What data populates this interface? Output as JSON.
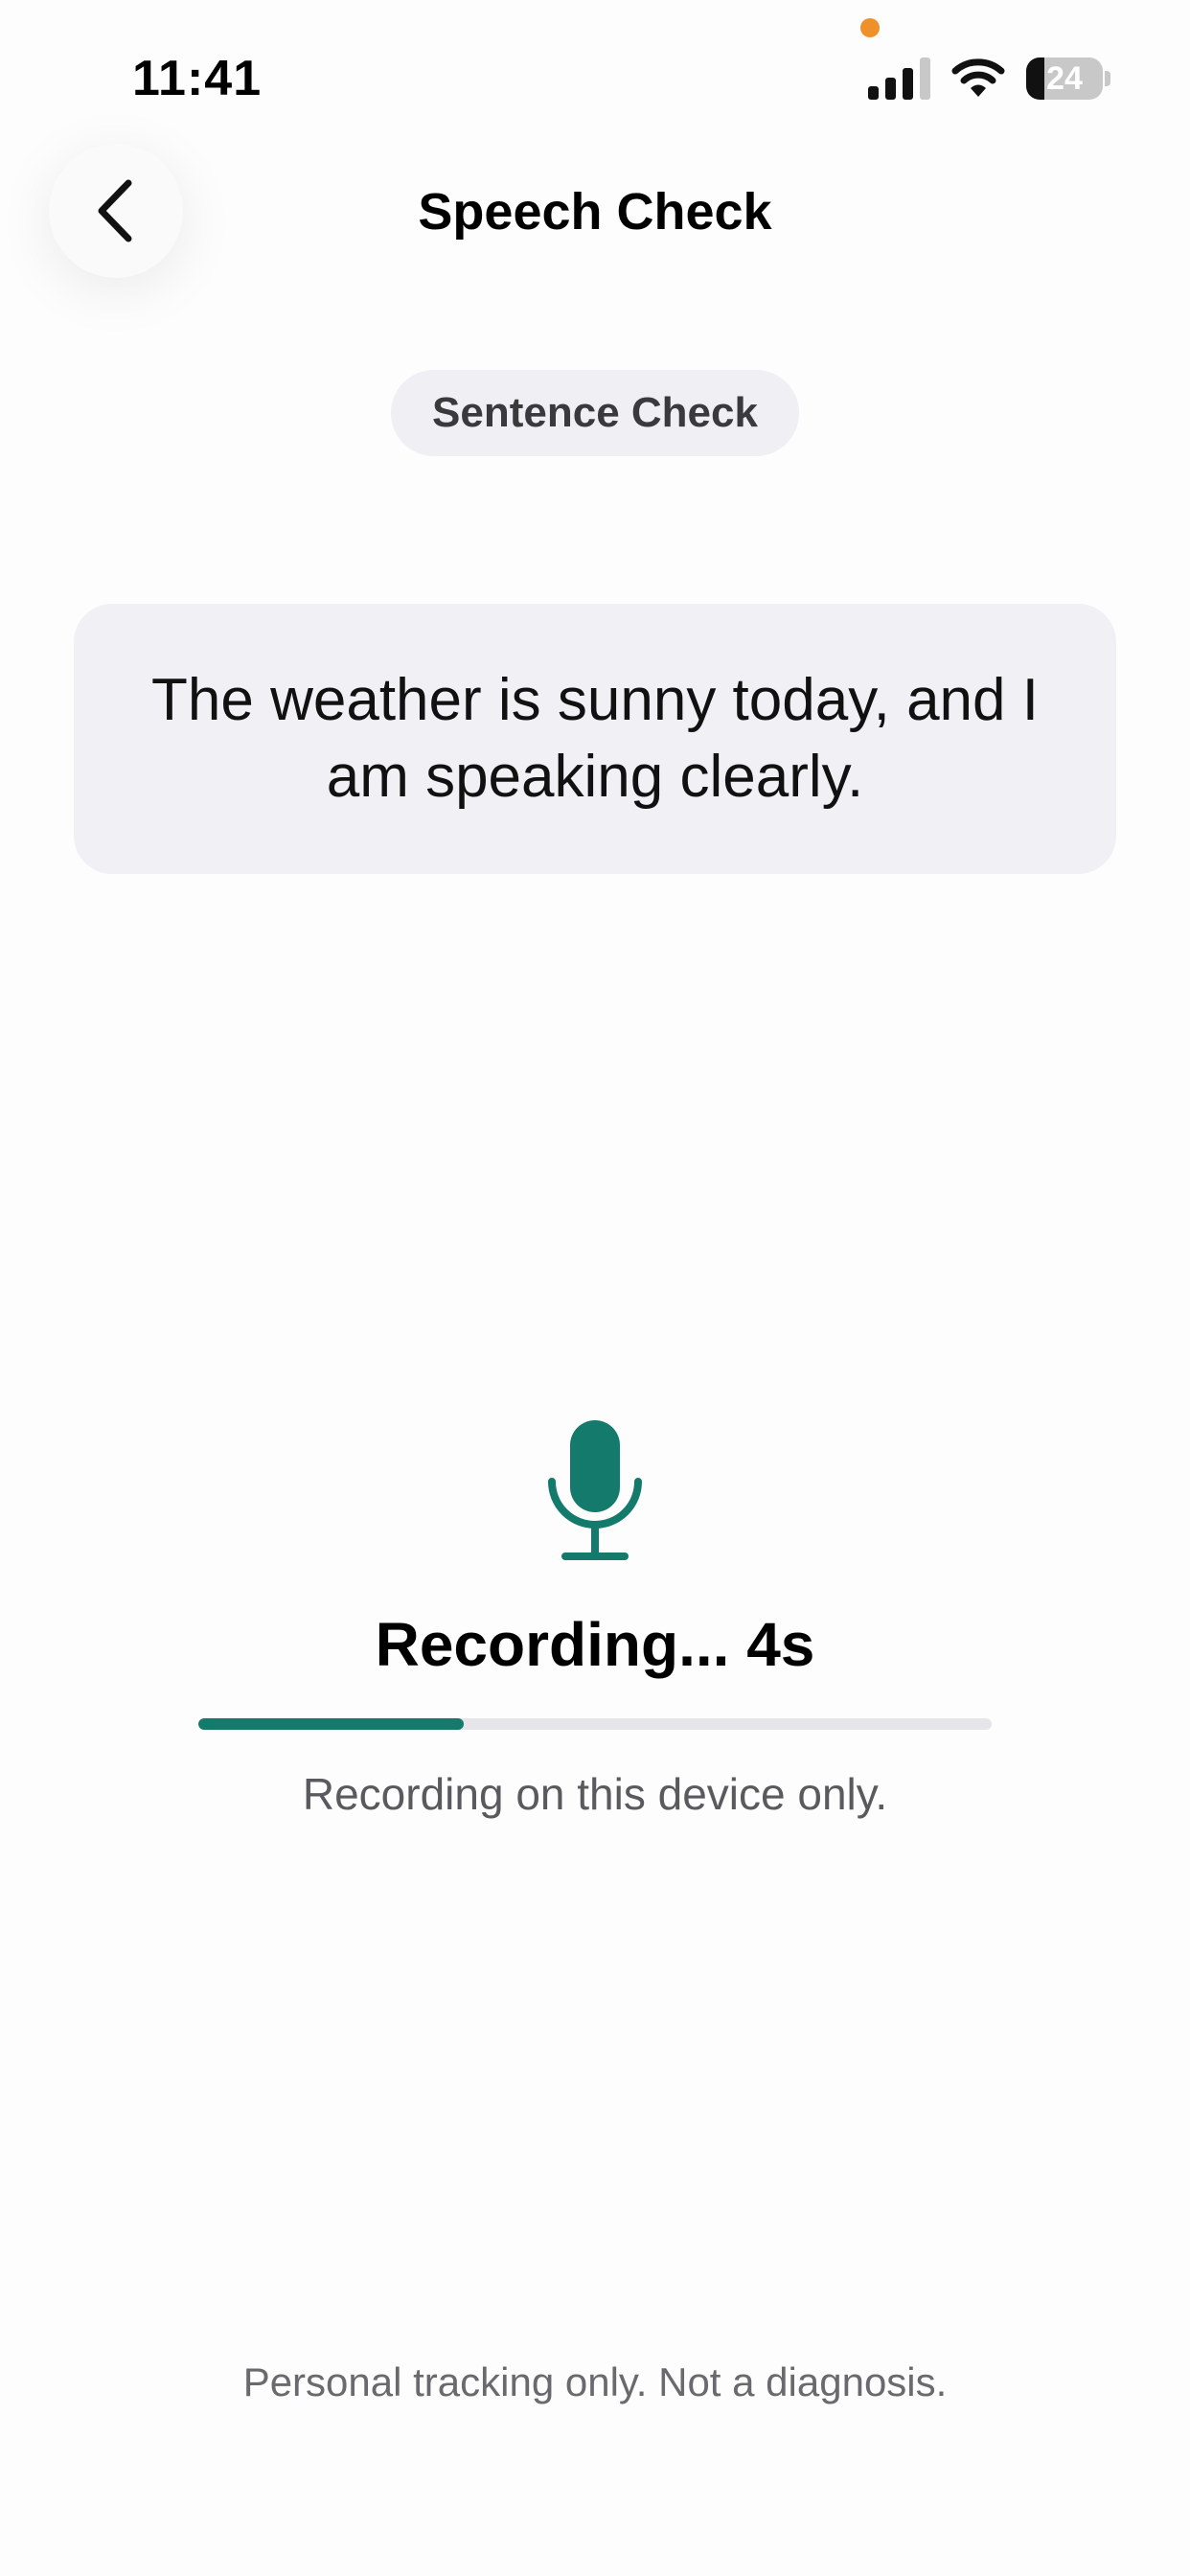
{
  "status_bar": {
    "time": "11:41",
    "battery_level": "24",
    "battery_fraction": 0.24,
    "icons": [
      "cellular-signal-icon",
      "wifi-icon",
      "battery-icon"
    ],
    "privacy_indicator_color": "#f0902a"
  },
  "nav": {
    "back_icon": "chevron-left-icon",
    "title": "Speech Check"
  },
  "chip": {
    "label": "Sentence Check"
  },
  "prompt": {
    "sentence": "The weather is sunny today, and I am speaking clearly."
  },
  "recording": {
    "icon": "microphone-icon",
    "status": "Recording... 4s",
    "progress_fraction": 0.335,
    "accent_color": "#147a6b",
    "note": "Recording on this device only."
  },
  "footer": {
    "disclaimer": "Personal tracking only. Not a diagnosis."
  }
}
